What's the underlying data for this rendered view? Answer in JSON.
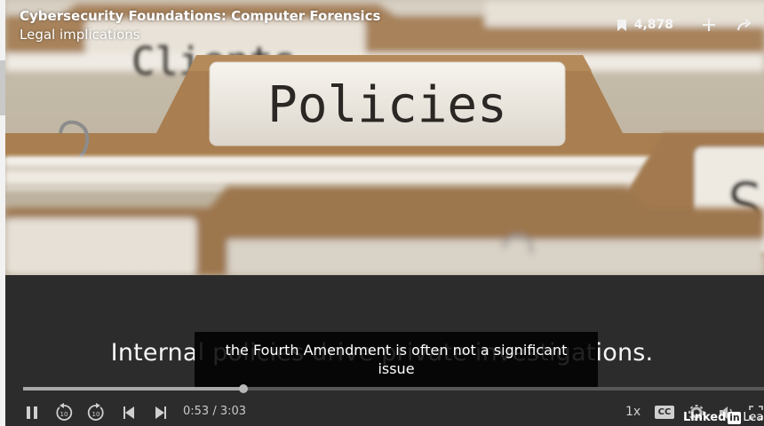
{
  "course": {
    "title": "Cybersecurity Foundations: Computer Forensics",
    "chapter": "Legal implications"
  },
  "top_actions": {
    "bookmark_count": "4,878",
    "icons": [
      "bookmark-icon",
      "add-icon",
      "share-icon"
    ]
  },
  "video": {
    "folder_tab_large": "Policies",
    "folder_tab_back": "Clients",
    "folder_tab_right": "S"
  },
  "slide": {
    "caption": "Internal policies drive private investigations."
  },
  "subtitle": {
    "line1": "the Fourth Amendment is often not a significant",
    "line2": "issue"
  },
  "playback": {
    "current_time": "0:53",
    "duration": "3:03",
    "time_display": "0:53 / 3:03",
    "progress_fraction": 0.297,
    "speed": "1x",
    "cc_label": "CC"
  },
  "controls": {
    "icons": [
      "pause-icon",
      "rewind-10-icon",
      "forward-10-icon",
      "previous-icon",
      "next-icon",
      "settings-icon",
      "volume-icon",
      "fullscreen-icon"
    ]
  },
  "brand": {
    "part1": "Linked",
    "in": "in",
    "part2": "Learni"
  },
  "colors": {
    "folder": "#a87d4f",
    "label": "#f3eee4",
    "panel": "#2c2c2c"
  }
}
